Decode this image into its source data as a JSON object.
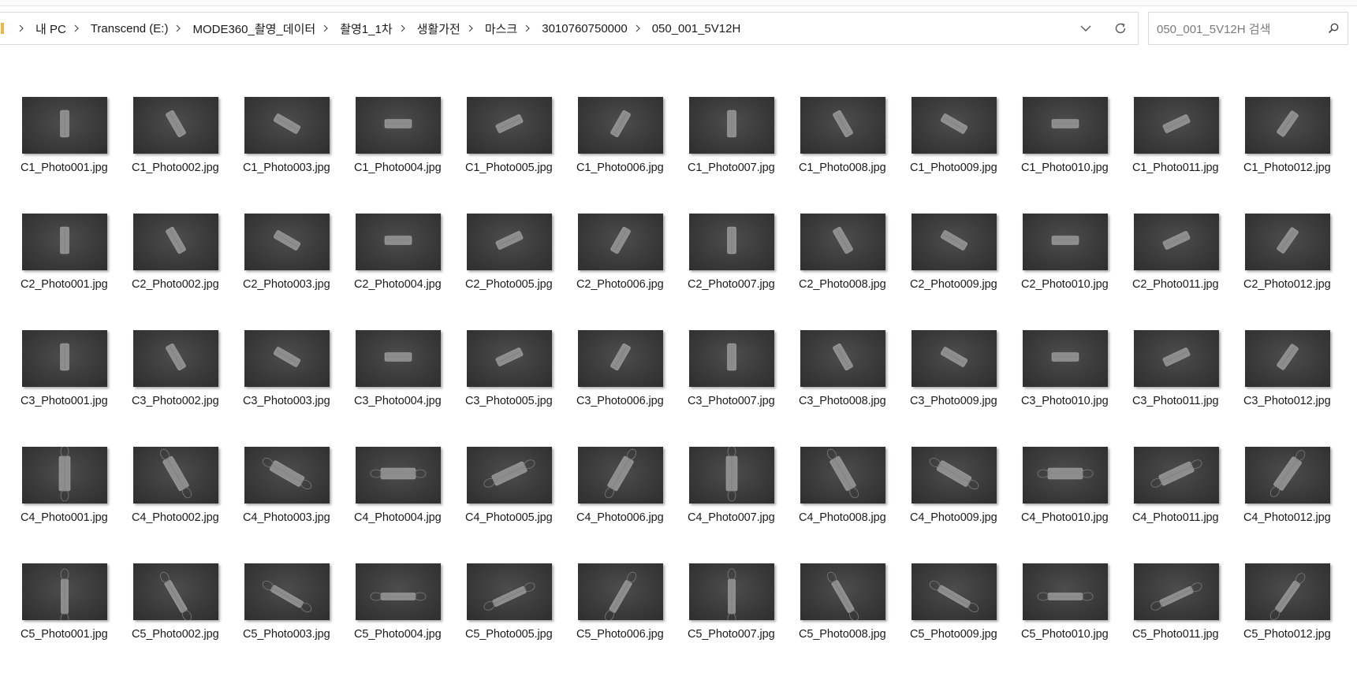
{
  "breadcrumbs": [
    "내 PC",
    "Transcend (E:)",
    "MODE360_촬영_데이터",
    "촬영1_1차",
    "생활가전",
    "마스크",
    "3010760750000",
    "050_001_5V12H"
  ],
  "address_bar": {
    "dropdown_icon": "chevron-down-icon",
    "refresh_icon": "refresh-icon"
  },
  "search": {
    "placeholder": "050_001_5V12H 검색",
    "icon": "search-icon"
  },
  "colors": {
    "folder": "#e8b84a",
    "thumb_bg": "#3b3b3b",
    "mask": "#8a8a8a"
  },
  "files": [
    "C1_Photo001.jpg",
    "C1_Photo002.jpg",
    "C1_Photo003.jpg",
    "C1_Photo004.jpg",
    "C1_Photo005.jpg",
    "C1_Photo006.jpg",
    "C1_Photo007.jpg",
    "C1_Photo008.jpg",
    "C1_Photo009.jpg",
    "C1_Photo010.jpg",
    "C1_Photo011.jpg",
    "C1_Photo012.jpg",
    "C2_Photo001.jpg",
    "C2_Photo002.jpg",
    "C2_Photo003.jpg",
    "C2_Photo004.jpg",
    "C2_Photo005.jpg",
    "C2_Photo006.jpg",
    "C2_Photo007.jpg",
    "C2_Photo008.jpg",
    "C2_Photo009.jpg",
    "C2_Photo010.jpg",
    "C2_Photo011.jpg",
    "C2_Photo012.jpg",
    "C3_Photo001.jpg",
    "C3_Photo002.jpg",
    "C3_Photo003.jpg",
    "C3_Photo004.jpg",
    "C3_Photo005.jpg",
    "C3_Photo006.jpg",
    "C3_Photo007.jpg",
    "C3_Photo008.jpg",
    "C3_Photo009.jpg",
    "C3_Photo010.jpg",
    "C3_Photo011.jpg",
    "C3_Photo012.jpg",
    "C4_Photo001.jpg",
    "C4_Photo002.jpg",
    "C4_Photo003.jpg",
    "C4_Photo004.jpg",
    "C4_Photo005.jpg",
    "C4_Photo006.jpg",
    "C4_Photo007.jpg",
    "C4_Photo008.jpg",
    "C4_Photo009.jpg",
    "C4_Photo010.jpg",
    "C4_Photo011.jpg",
    "C4_Photo012.jpg",
    "C5_Photo001.jpg",
    "C5_Photo002.jpg",
    "C5_Photo003.jpg",
    "C5_Photo004.jpg",
    "C5_Photo005.jpg",
    "C5_Photo006.jpg",
    "C5_Photo007.jpg",
    "C5_Photo008.jpg",
    "C5_Photo009.jpg",
    "C5_Photo010.jpg",
    "C5_Photo011.jpg",
    "C5_Photo012.jpg"
  ]
}
